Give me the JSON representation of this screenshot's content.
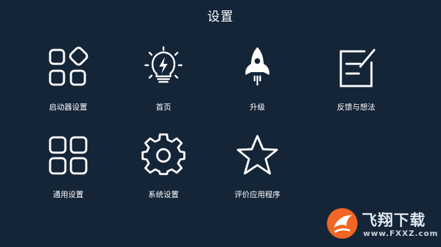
{
  "header": {
    "title": "设置"
  },
  "tiles": [
    {
      "label": "启动器设置",
      "icon": "launcher-grid-icon"
    },
    {
      "label": "首页",
      "icon": "lightbulb-icon"
    },
    {
      "label": "升级",
      "icon": "rocket-icon"
    },
    {
      "label": "反馈与想法",
      "icon": "feedback-edit-icon"
    },
    {
      "label": "通用设置",
      "icon": "grid-icon"
    },
    {
      "label": "系统设置",
      "icon": "gear-icon"
    },
    {
      "label": "评价应用程序",
      "icon": "star-icon"
    }
  ],
  "watermark": {
    "text": "飞翔下载",
    "url": "www.FXXZ.com"
  },
  "colors": {
    "background": "#142538",
    "foreground": "#ffffff",
    "watermark_orange": "#f26522"
  }
}
